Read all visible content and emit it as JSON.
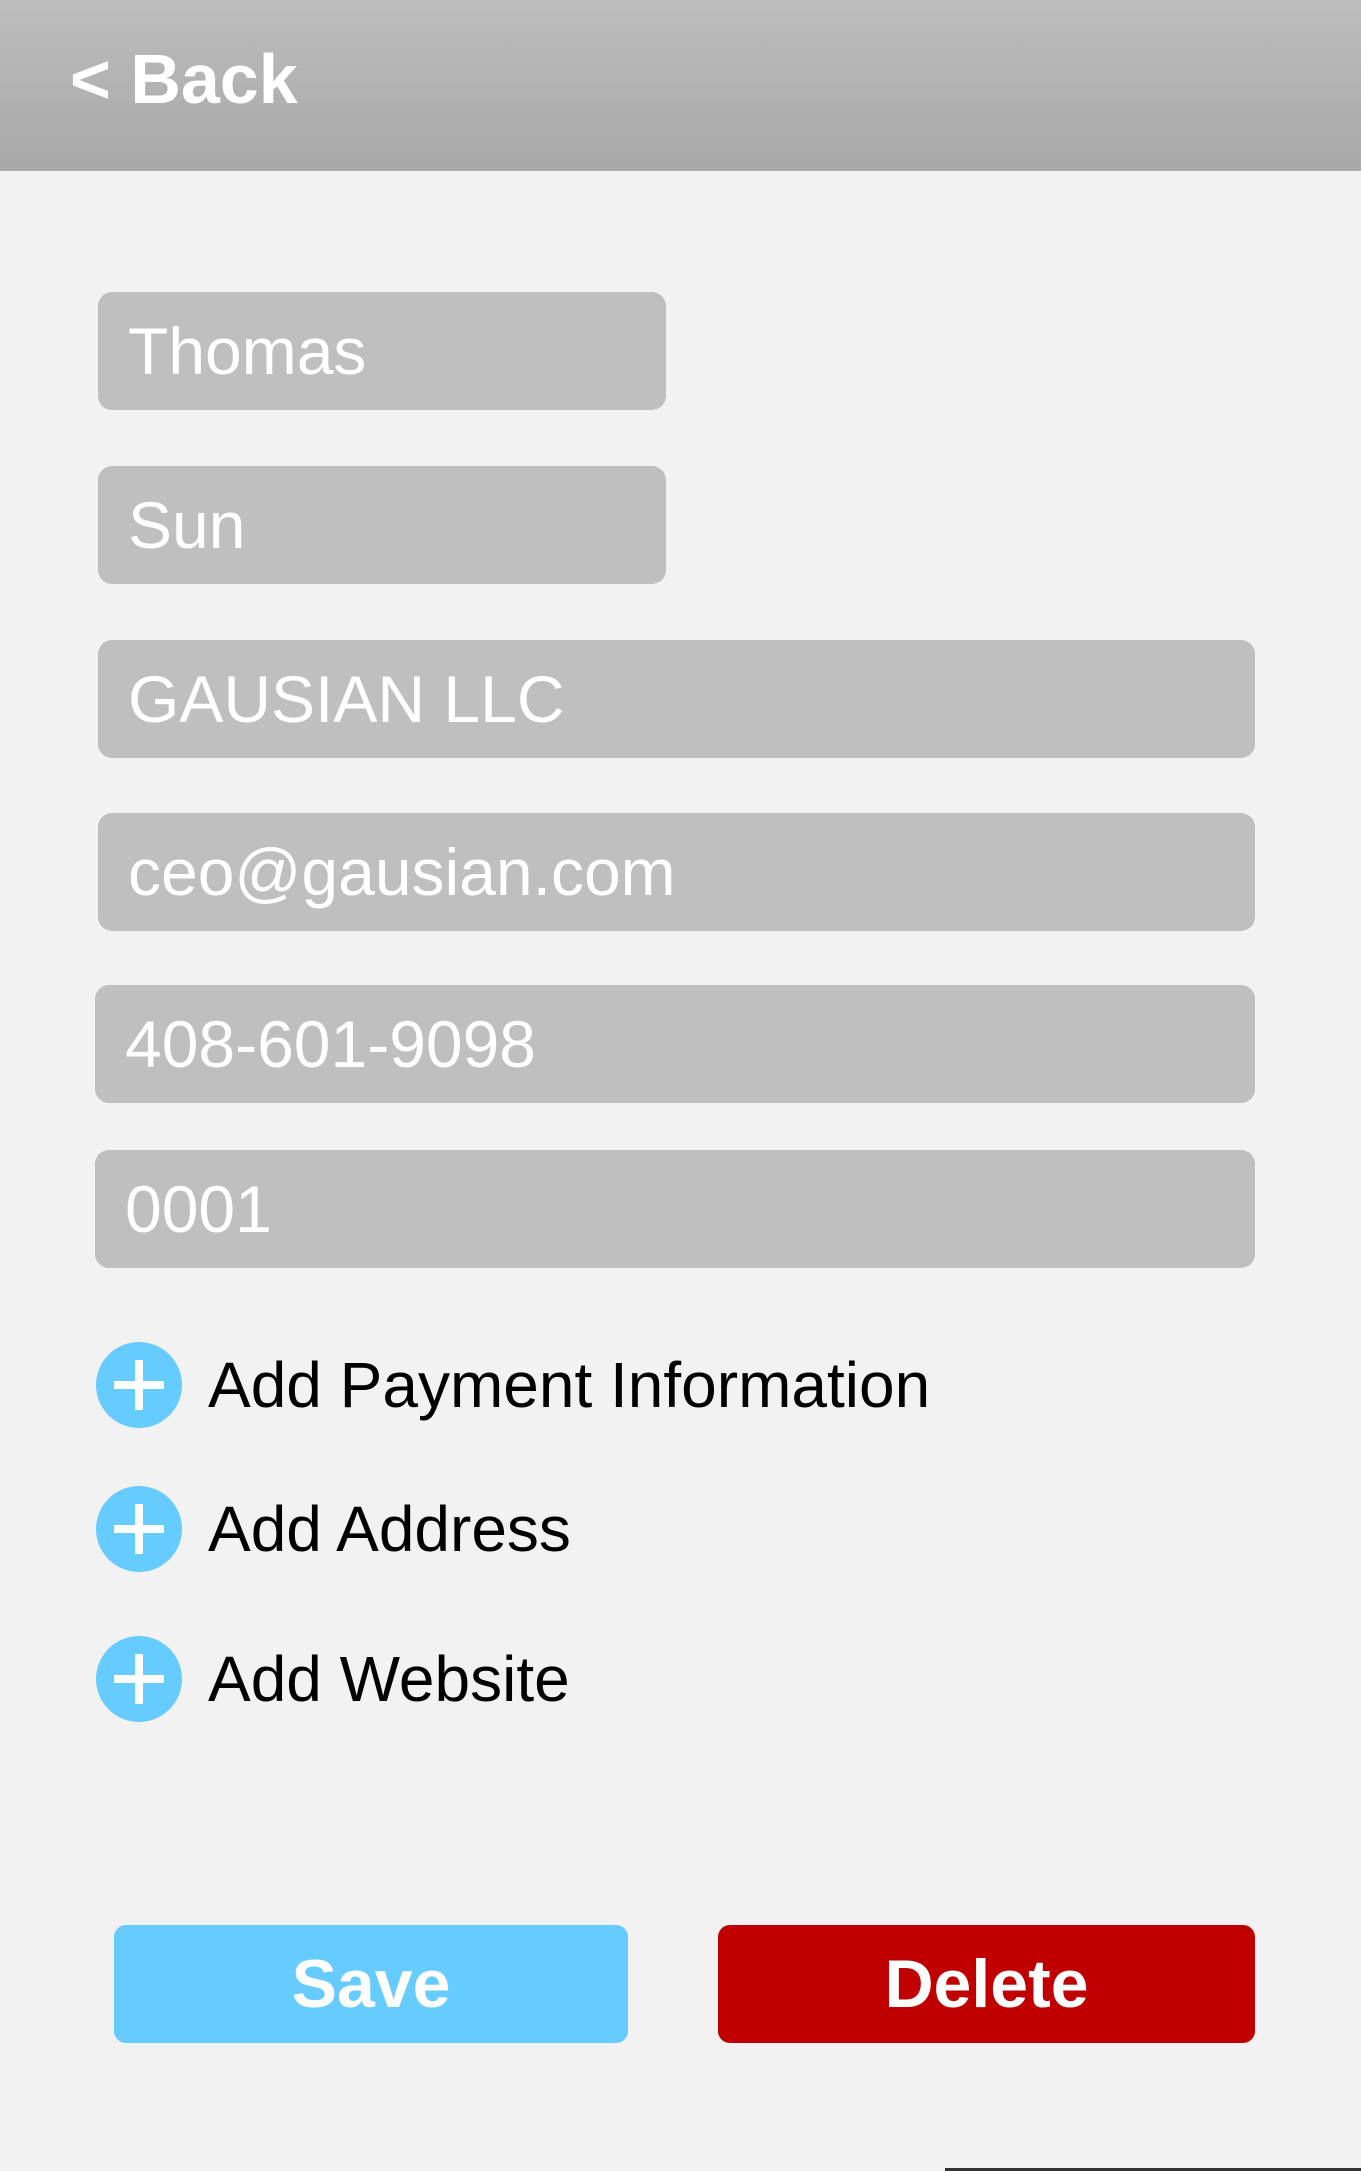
{
  "header": {
    "back_label": "< Back"
  },
  "form": {
    "first_name": "Thomas",
    "last_name": "Sun",
    "company": "GAUSIAN LLC",
    "email": "ceo@gausian.com",
    "phone": "408-601-9098",
    "extension": "0001"
  },
  "actions": {
    "add_payment": "Add Payment Information",
    "add_address": "Add Address",
    "add_website": "Add Website"
  },
  "buttons": {
    "save": "Save",
    "delete": "Delete"
  },
  "colors": {
    "accent": "#66ccff",
    "danger": "#c00000",
    "field_bg": "#bfbfbf",
    "page_bg": "#f2f2f2"
  }
}
